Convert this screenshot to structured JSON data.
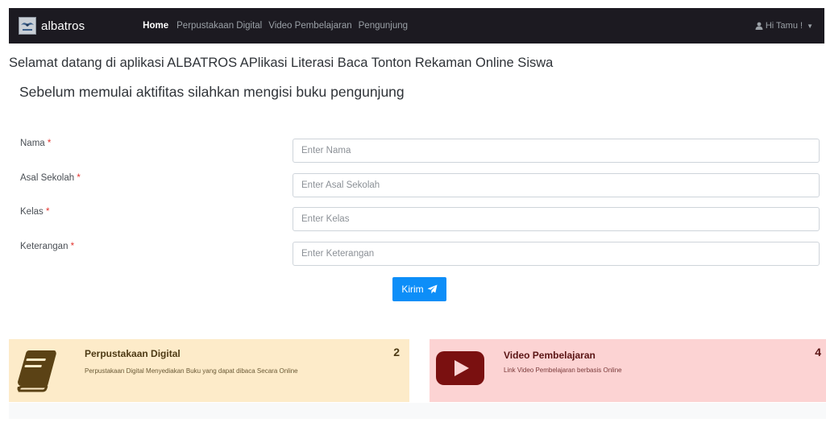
{
  "navbar": {
    "brand": "albatros",
    "logo_icon": "albatros-logo-icon",
    "links": [
      {
        "label": "Home",
        "active": true
      },
      {
        "label": "Perpustakaan Digital",
        "active": false
      },
      {
        "label": "Video Pembelajaran",
        "active": false
      },
      {
        "label": "Pengunjung",
        "active": false
      }
    ],
    "user": {
      "icon": "user-icon",
      "label": "Hi Tamu !",
      "caret_icon": "caret-down-icon"
    }
  },
  "welcome": "Selamat datang di aplikasi ALBATROS APlikasi Literasi Baca Tonton Rekaman Online Siswa",
  "subtitle": "Sebelum memulai aktifitas silahkan mengisi buku pengunjung",
  "form": {
    "required_mark": "*",
    "fields": [
      {
        "label": "Nama",
        "placeholder": "Enter Nama",
        "value": ""
      },
      {
        "label": "Asal Sekolah",
        "placeholder": "Enter Asal Sekolah",
        "value": ""
      },
      {
        "label": "Kelas",
        "placeholder": "Enter Kelas",
        "value": ""
      },
      {
        "label": "Keterangan",
        "placeholder": "Enter Keterangan",
        "value": ""
      }
    ],
    "submit_label": "Kirim",
    "submit_icon": "paper-plane-icon"
  },
  "cards": [
    {
      "title": "Perpustakaan Digital",
      "description": "Perpustakaan Digital Menyediakan Buku yang dapat dibaca Secara Online",
      "count": "2",
      "icon": "book-icon"
    },
    {
      "title": "Video Pembelajaran",
      "description": "Link Video Pembelajaran berbasis Online",
      "count": "4",
      "icon": "youtube-play-icon"
    }
  ],
  "colors": {
    "navbar_bg": "#1c1a21",
    "primary": "#0d8ef8",
    "required": "#e3342f",
    "card_yellow_bg": "#fdebc9",
    "card_red_bg": "#fcd3d3",
    "book_icon": "#5b4215",
    "youtube_icon": "#7a1010"
  }
}
